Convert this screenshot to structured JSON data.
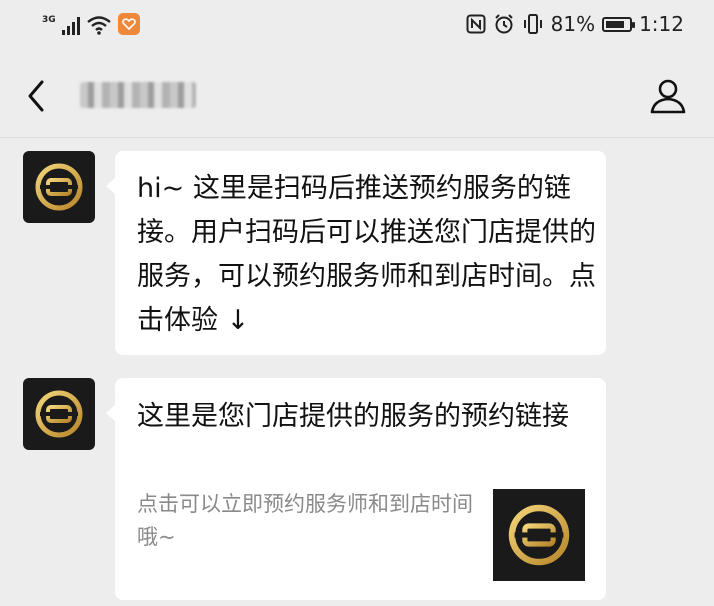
{
  "status_bar": {
    "network": "3G",
    "battery_percent": "81%",
    "time": "1:12"
  },
  "header": {
    "title": "█████"
  },
  "messages": [
    {
      "type": "text",
      "text": "hi~ 这里是扫码后推送预约服务的链接。用户扫码后可以推送您门店提供的服务，可以预约服务师和到店时间。点击体验 ↓"
    },
    {
      "type": "link_card",
      "title": "这里是您门店提供的服务的预约链接",
      "description": "点击可以立即预约服务师和到店时间哦~"
    }
  ],
  "colors": {
    "background": "#ededed",
    "bubble": "#ffffff",
    "avatar_bg": "#1a1a1a",
    "logo_gold": "#d9b04a",
    "app_badge": "#f0883c"
  },
  "icons": {
    "back": "chevron-left-icon",
    "profile": "person-icon",
    "logo": "gold-ring-logo-icon"
  }
}
